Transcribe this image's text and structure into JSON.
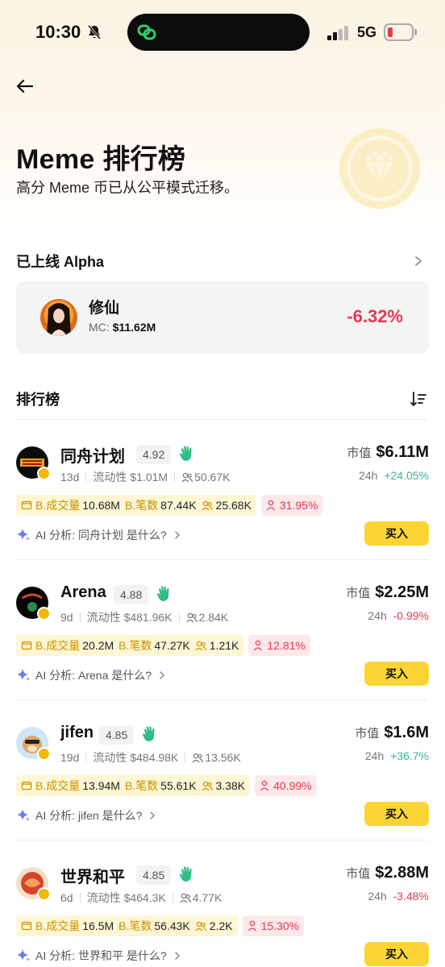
{
  "status": {
    "time": "10:30",
    "network": "5G"
  },
  "header": {
    "title": "Meme 排行榜",
    "subtitle": "高分 Meme 币已从公平模式迁移。"
  },
  "alpha": {
    "section_title": "已上线 Alpha",
    "card": {
      "name": "修仙",
      "mc_label": "MC:",
      "mc_value": "$11.62M",
      "change": "-6.32%"
    }
  },
  "ranking": {
    "section_title": "排行榜",
    "mc_label": "市值",
    "period_label": "24h",
    "volume_label": "B.成交量",
    "trades_label": "B.笔数",
    "liquidity_label": "流动性",
    "ai_prefix": "AI 分析:",
    "buy_label": "买入",
    "items": [
      {
        "name": "同舟计划",
        "score": "4.92",
        "age": "13d",
        "liquidity": "$1.01M",
        "holders": "50.67K",
        "mc": "$6.11M",
        "change": "+24.05%",
        "change_dir": "up",
        "volume": "10.68M",
        "trades": "87.44K",
        "traders": "25.68K",
        "pct": "31.95%",
        "ai_text": "同舟计划 是什么?"
      },
      {
        "name": "Arena",
        "score": "4.88",
        "age": "9d",
        "liquidity": "$481.96K",
        "holders": "2.84K",
        "mc": "$2.25M",
        "change": "-0.99%",
        "change_dir": "down",
        "volume": "20.2M",
        "trades": "47.27K",
        "traders": "1.21K",
        "pct": "12.81%",
        "ai_text": "Arena 是什么?"
      },
      {
        "name": "jifen",
        "score": "4.85",
        "age": "19d",
        "liquidity": "$484.98K",
        "holders": "13.56K",
        "mc": "$1.6M",
        "change": "+36.7%",
        "change_dir": "up",
        "volume": "13.94M",
        "trades": "55.61K",
        "traders": "3.38K",
        "pct": "40.99%",
        "ai_text": "jifen 是什么?"
      },
      {
        "name": "世界和平",
        "score": "4.85",
        "age": "6d",
        "liquidity": "$464.3K",
        "holders": "4.77K",
        "mc": "$2.88M",
        "change": "-3.48%",
        "change_dir": "down",
        "volume": "16.5M",
        "trades": "56.43K",
        "traders": "2.2K",
        "pct": "15.30%",
        "ai_text": "世界和平 是什么?"
      }
    ]
  },
  "colors": {
    "accent": "#fcd535",
    "up": "#2ebd85",
    "down": "#e8384f",
    "chip_bg": "#fff6d5"
  },
  "icons": [
    "back-arrow-icon",
    "bell-slash-icon",
    "link-icon",
    "signal-icon",
    "battery-icon",
    "diamond-icon",
    "chevron-right-icon",
    "sort-icon",
    "wave-hand-icon",
    "people-icon",
    "wallet-icon",
    "sparkle-icon"
  ]
}
